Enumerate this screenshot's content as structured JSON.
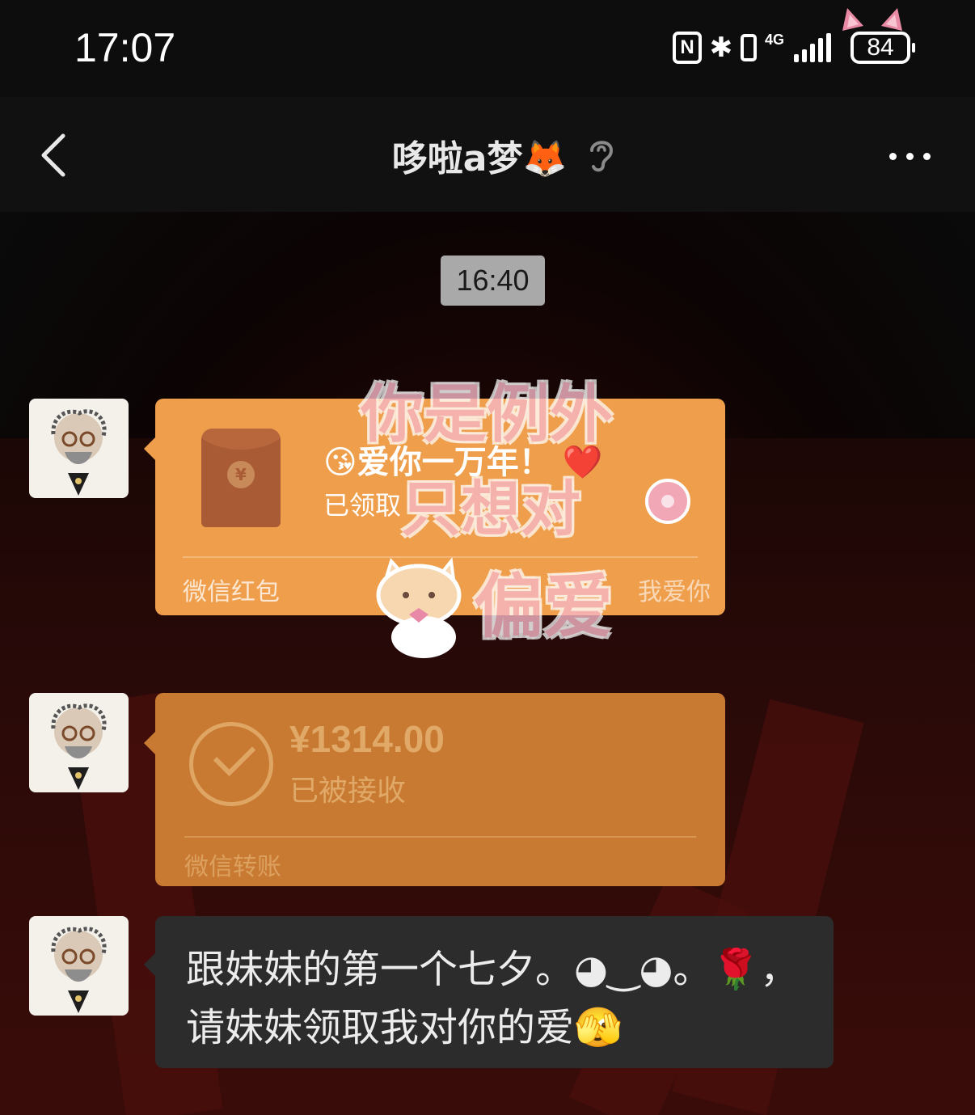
{
  "status_bar": {
    "time": "17:07",
    "network": "4G",
    "battery": "84"
  },
  "header": {
    "title": "哆啦a梦🦊"
  },
  "messages": {
    "timestamp": "16:40",
    "red_packet": {
      "title": "😘爱你一万年！ ❤️",
      "status": "已领取",
      "type": "微信红包",
      "note": "我爱你"
    },
    "transfer": {
      "amount": "¥1314.00",
      "status": "已被接收",
      "type": "微信转账"
    },
    "text_message": {
      "line1": "跟妹妹的第一个七夕。◕‿◕。🌹，",
      "line2": "请妹妹领取我对你的爱🫣"
    }
  },
  "sticker": {
    "lines": [
      "你是例外",
      "只想对",
      "偏爱"
    ]
  },
  "colors": {
    "red_packet": "#ef9f4c",
    "transfer": "#c97a32",
    "text_bubble": "#2c2c2c",
    "timestamp_bg": "#a9a9a9"
  }
}
